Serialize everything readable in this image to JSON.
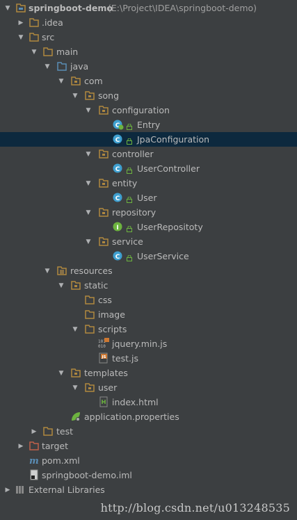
{
  "project": {
    "name": "springboot-demo",
    "path": "(E:\\Project\\IDEA\\springboot-demo)"
  },
  "tree": {
    "idea": ".idea",
    "src": "src",
    "main": "main",
    "java": "java",
    "com": "com",
    "song": "song",
    "configuration": "configuration",
    "entry": "Entry",
    "jpa_configuration": "JpaConfiguration",
    "controller": "controller",
    "user_controller": "UserController",
    "entity": "entity",
    "user": "User",
    "repository": "repository",
    "user_repository": "UserRepositoty",
    "service": "service",
    "user_service": "UserService",
    "resources": "resources",
    "static": "static",
    "css": "css",
    "image": "image",
    "scripts": "scripts",
    "jquery": "jquery.min.js",
    "testjs": "test.js",
    "templates": "templates",
    "user_folder": "user",
    "index_html": "index.html",
    "app_properties": "application.properties",
    "test": "test",
    "target": "target",
    "pom": "pom.xml",
    "iml": "springboot-demo.iml",
    "external_libraries": "External Libraries"
  },
  "watermark": "http://blog.csdn.net/u013248535",
  "colors": {
    "background": "#3c3f41",
    "selection": "#0d293e",
    "text": "#bbbbbb",
    "folder": "#b0883f",
    "source_folder": "#5a8db5",
    "class_badge": "#3fa0d0",
    "interface_badge": "#6db33f"
  }
}
